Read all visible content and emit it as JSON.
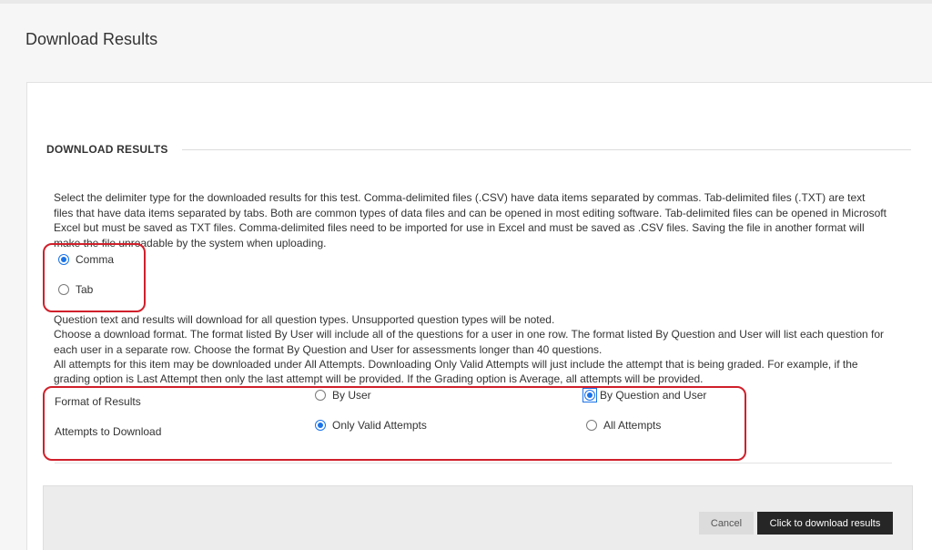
{
  "page": {
    "title": "Download Results"
  },
  "section": {
    "heading": "DOWNLOAD RESULTS",
    "description": "Select the delimiter type for the downloaded results for this test. Comma-delimited files (.CSV) have data items separated by commas. Tab-delimited files (.TXT) are text files that have data items separated by tabs. Both are common types of data files and can be opened in most editing software. Tab-delimited files can be opened in Microsoft Excel but must be saved as TXT files. Comma-delimited files need to be imported for use in Excel and must be saved as .CSV files. Saving the file in another format will make the file unreadable by the system when uploading."
  },
  "delimiter": {
    "options": [
      {
        "label": "Comma",
        "checked": true
      },
      {
        "label": "Tab",
        "checked": false
      }
    ]
  },
  "info": {
    "line1": "Question text and results will download for all question types. Unsupported question types will be noted.",
    "line2": "Choose a download format. The format listed By User will include all of the questions for a user in one row. The format listed By Question and User will list each question for each user in a separate row. Choose the format By Question and User for assessments longer than 40 questions.",
    "line3": "All attempts for this item may be downloaded under All Attempts. Downloading Only Valid Attempts will just include the attempt that is being graded. For example, if the grading option is Last Attempt then only the last attempt will be provided. If the Grading option is Average, all attempts will be provided."
  },
  "format": {
    "label": "Format of Results",
    "options": [
      {
        "label": "By User",
        "checked": false
      },
      {
        "label": "By Question and User",
        "checked": true
      }
    ]
  },
  "attempts": {
    "label": "Attempts to Download",
    "options": [
      {
        "label": "Only Valid Attempts",
        "checked": true
      },
      {
        "label": "All Attempts",
        "checked": false
      }
    ]
  },
  "footer": {
    "cancel_label": "Cancel",
    "submit_label": "Click to download results"
  },
  "colors": {
    "annotation": "#d0202b",
    "radio_accent": "#1a73e8",
    "primary_button": "#262626"
  }
}
